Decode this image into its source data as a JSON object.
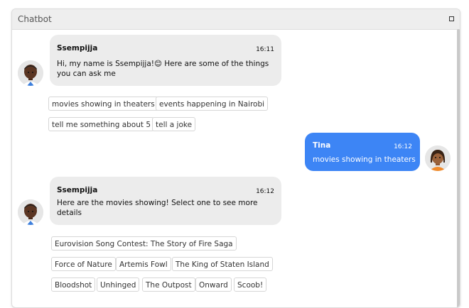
{
  "window": {
    "title": "Chatbot"
  },
  "messages": [
    {
      "sender": "Ssempijja",
      "time": "16:11",
      "text": "Hi, my name is Ssempijja!😊  Here are some of the things you can ask me"
    },
    {
      "sender": "Tina",
      "time": "16:12",
      "text": "movies showing in theaters"
    },
    {
      "sender": "Ssempijja",
      "time": "16:12",
      "text": "Here are the movies showing! Select one to see more details"
    }
  ],
  "suggestions_1": [
    "movies showing in theaters",
    "events happening in Nairobi",
    "tell me something about 5",
    "tell a joke"
  ],
  "suggestions_2": [
    "Eurovision Song Contest: The Story of Fire Saga",
    "Force of Nature",
    "Artemis Fowl",
    "The King of Staten Island",
    "Bloodshot",
    "Unhinged",
    "The Outpost",
    "Onward",
    "Scoob!"
  ]
}
